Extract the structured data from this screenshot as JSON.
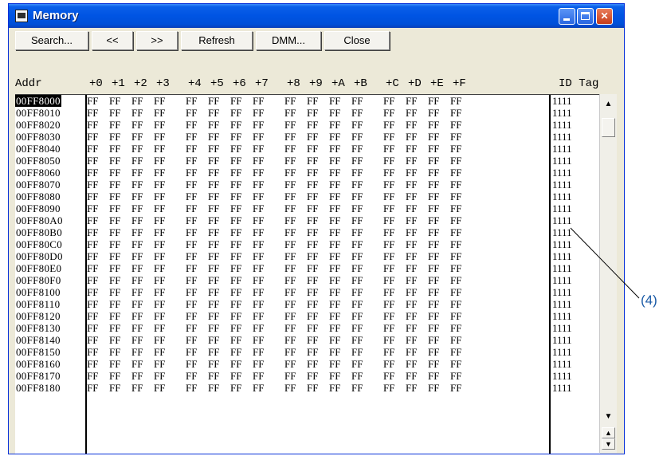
{
  "window": {
    "title": "Memory"
  },
  "toolbar": {
    "buttons": [
      "Search...",
      "<<",
      ">>",
      "Refresh",
      "DMM...",
      "Close"
    ]
  },
  "columns": {
    "addr": "Addr",
    "offsets": [
      "+0",
      "+1",
      "+2",
      "+3",
      "+4",
      "+5",
      "+6",
      "+7",
      "+8",
      "+9",
      "+A",
      "+B",
      "+C",
      "+D",
      "+E",
      "+F"
    ],
    "idtag": "ID Tag"
  },
  "rows": [
    {
      "addr": "00FF8000",
      "values": [
        "FF",
        "FF",
        "FF",
        "FF",
        "FF",
        "FF",
        "FF",
        "FF",
        "FF",
        "FF",
        "FF",
        "FF",
        "FF",
        "FF",
        "FF",
        "FF"
      ],
      "idtag": "1111"
    },
    {
      "addr": "00FF8010",
      "values": [
        "FF",
        "FF",
        "FF",
        "FF",
        "FF",
        "FF",
        "FF",
        "FF",
        "FF",
        "FF",
        "FF",
        "FF",
        "FF",
        "FF",
        "FF",
        "FF"
      ],
      "idtag": "1111"
    },
    {
      "addr": "00FF8020",
      "values": [
        "FF",
        "FF",
        "FF",
        "FF",
        "FF",
        "FF",
        "FF",
        "FF",
        "FF",
        "FF",
        "FF",
        "FF",
        "FF",
        "FF",
        "FF",
        "FF"
      ],
      "idtag": "1111"
    },
    {
      "addr": "00FF8030",
      "values": [
        "FF",
        "FF",
        "FF",
        "FF",
        "FF",
        "FF",
        "FF",
        "FF",
        "FF",
        "FF",
        "FF",
        "FF",
        "FF",
        "FF",
        "FF",
        "FF"
      ],
      "idtag": "1111"
    },
    {
      "addr": "00FF8040",
      "values": [
        "FF",
        "FF",
        "FF",
        "FF",
        "FF",
        "FF",
        "FF",
        "FF",
        "FF",
        "FF",
        "FF",
        "FF",
        "FF",
        "FF",
        "FF",
        "FF"
      ],
      "idtag": "1111"
    },
    {
      "addr": "00FF8050",
      "values": [
        "FF",
        "FF",
        "FF",
        "FF",
        "FF",
        "FF",
        "FF",
        "FF",
        "FF",
        "FF",
        "FF",
        "FF",
        "FF",
        "FF",
        "FF",
        "FF"
      ],
      "idtag": "1111"
    },
    {
      "addr": "00FF8060",
      "values": [
        "FF",
        "FF",
        "FF",
        "FF",
        "FF",
        "FF",
        "FF",
        "FF",
        "FF",
        "FF",
        "FF",
        "FF",
        "FF",
        "FF",
        "FF",
        "FF"
      ],
      "idtag": "1111"
    },
    {
      "addr": "00FF8070",
      "values": [
        "FF",
        "FF",
        "FF",
        "FF",
        "FF",
        "FF",
        "FF",
        "FF",
        "FF",
        "FF",
        "FF",
        "FF",
        "FF",
        "FF",
        "FF",
        "FF"
      ],
      "idtag": "1111"
    },
    {
      "addr": "00FF8080",
      "values": [
        "FF",
        "FF",
        "FF",
        "FF",
        "FF",
        "FF",
        "FF",
        "FF",
        "FF",
        "FF",
        "FF",
        "FF",
        "FF",
        "FF",
        "FF",
        "FF"
      ],
      "idtag": "1111"
    },
    {
      "addr": "00FF8090",
      "values": [
        "FF",
        "FF",
        "FF",
        "FF",
        "FF",
        "FF",
        "FF",
        "FF",
        "FF",
        "FF",
        "FF",
        "FF",
        "FF",
        "FF",
        "FF",
        "FF"
      ],
      "idtag": "1111"
    },
    {
      "addr": "00FF80A0",
      "values": [
        "FF",
        "FF",
        "FF",
        "FF",
        "FF",
        "FF",
        "FF",
        "FF",
        "FF",
        "FF",
        "FF",
        "FF",
        "FF",
        "FF",
        "FF",
        "FF"
      ],
      "idtag": "1111"
    },
    {
      "addr": "00FF80B0",
      "values": [
        "FF",
        "FF",
        "FF",
        "FF",
        "FF",
        "FF",
        "FF",
        "FF",
        "FF",
        "FF",
        "FF",
        "FF",
        "FF",
        "FF",
        "FF",
        "FF"
      ],
      "idtag": "1111"
    },
    {
      "addr": "00FF80C0",
      "values": [
        "FF",
        "FF",
        "FF",
        "FF",
        "FF",
        "FF",
        "FF",
        "FF",
        "FF",
        "FF",
        "FF",
        "FF",
        "FF",
        "FF",
        "FF",
        "FF"
      ],
      "idtag": "1111"
    },
    {
      "addr": "00FF80D0",
      "values": [
        "FF",
        "FF",
        "FF",
        "FF",
        "FF",
        "FF",
        "FF",
        "FF",
        "FF",
        "FF",
        "FF",
        "FF",
        "FF",
        "FF",
        "FF",
        "FF"
      ],
      "idtag": "1111"
    },
    {
      "addr": "00FF80E0",
      "values": [
        "FF",
        "FF",
        "FF",
        "FF",
        "FF",
        "FF",
        "FF",
        "FF",
        "FF",
        "FF",
        "FF",
        "FF",
        "FF",
        "FF",
        "FF",
        "FF"
      ],
      "idtag": "1111"
    },
    {
      "addr": "00FF80F0",
      "values": [
        "FF",
        "FF",
        "FF",
        "FF",
        "FF",
        "FF",
        "FF",
        "FF",
        "FF",
        "FF",
        "FF",
        "FF",
        "FF",
        "FF",
        "FF",
        "FF"
      ],
      "idtag": "1111"
    },
    {
      "addr": "00FF8100",
      "values": [
        "FF",
        "FF",
        "FF",
        "FF",
        "FF",
        "FF",
        "FF",
        "FF",
        "FF",
        "FF",
        "FF",
        "FF",
        "FF",
        "FF",
        "FF",
        "FF"
      ],
      "idtag": "1111"
    },
    {
      "addr": "00FF8110",
      "values": [
        "FF",
        "FF",
        "FF",
        "FF",
        "FF",
        "FF",
        "FF",
        "FF",
        "FF",
        "FF",
        "FF",
        "FF",
        "FF",
        "FF",
        "FF",
        "FF"
      ],
      "idtag": "1111"
    },
    {
      "addr": "00FF8120",
      "values": [
        "FF",
        "FF",
        "FF",
        "FF",
        "FF",
        "FF",
        "FF",
        "FF",
        "FF",
        "FF",
        "FF",
        "FF",
        "FF",
        "FF",
        "FF",
        "FF"
      ],
      "idtag": "1111"
    },
    {
      "addr": "00FF8130",
      "values": [
        "FF",
        "FF",
        "FF",
        "FF",
        "FF",
        "FF",
        "FF",
        "FF",
        "FF",
        "FF",
        "FF",
        "FF",
        "FF",
        "FF",
        "FF",
        "FF"
      ],
      "idtag": "1111"
    },
    {
      "addr": "00FF8140",
      "values": [
        "FF",
        "FF",
        "FF",
        "FF",
        "FF",
        "FF",
        "FF",
        "FF",
        "FF",
        "FF",
        "FF",
        "FF",
        "FF",
        "FF",
        "FF",
        "FF"
      ],
      "idtag": "1111"
    },
    {
      "addr": "00FF8150",
      "values": [
        "FF",
        "FF",
        "FF",
        "FF",
        "FF",
        "FF",
        "FF",
        "FF",
        "FF",
        "FF",
        "FF",
        "FF",
        "FF",
        "FF",
        "FF",
        "FF"
      ],
      "idtag": "1111"
    },
    {
      "addr": "00FF8160",
      "values": [
        "FF",
        "FF",
        "FF",
        "FF",
        "FF",
        "FF",
        "FF",
        "FF",
        "FF",
        "FF",
        "FF",
        "FF",
        "FF",
        "FF",
        "FF",
        "FF"
      ],
      "idtag": "1111"
    },
    {
      "addr": "00FF8170",
      "values": [
        "FF",
        "FF",
        "FF",
        "FF",
        "FF",
        "FF",
        "FF",
        "FF",
        "FF",
        "FF",
        "FF",
        "FF",
        "FF",
        "FF",
        "FF",
        "FF"
      ],
      "idtag": "1111"
    },
    {
      "addr": "00FF8180",
      "values": [
        "FF",
        "FF",
        "FF",
        "FF",
        "FF",
        "FF",
        "FF",
        "FF",
        "FF",
        "FF",
        "FF",
        "FF",
        "FF",
        "FF",
        "FF",
        "FF"
      ],
      "idtag": "1111"
    }
  ],
  "selected_row": 0,
  "annotation": {
    "label": "(4)"
  },
  "colors": {
    "titlebar": "#0054e3",
    "annotation": "#1a5aa6"
  }
}
